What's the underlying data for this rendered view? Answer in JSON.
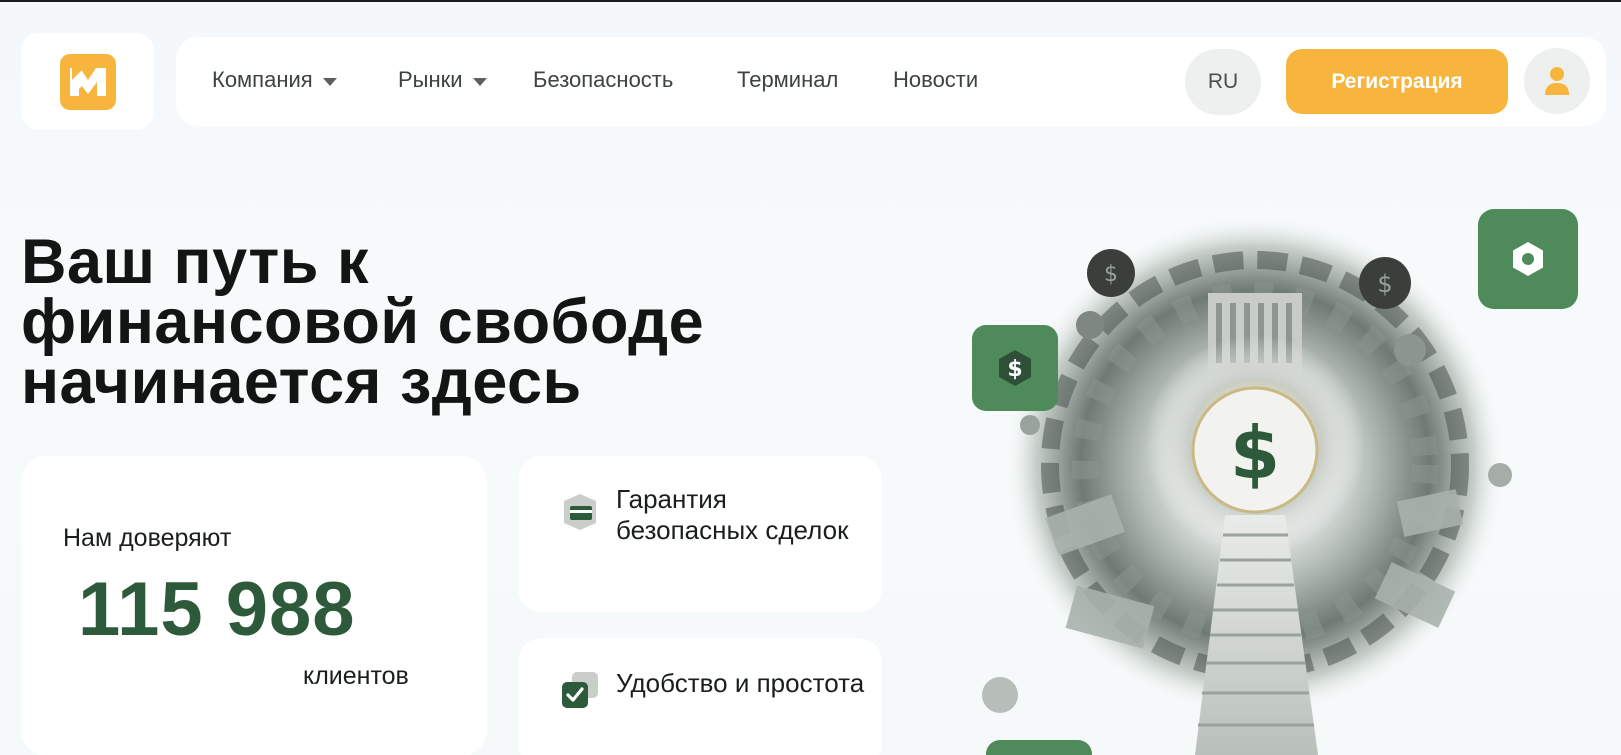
{
  "header": {
    "nav": [
      {
        "label": "Компания",
        "has_dropdown": true
      },
      {
        "label": "Рынки",
        "has_dropdown": true
      },
      {
        "label": "Безопасность",
        "has_dropdown": false
      },
      {
        "label": "Терминал",
        "has_dropdown": false
      },
      {
        "label": "Новости",
        "has_dropdown": false
      }
    ],
    "language": "RU",
    "register_label": "Регистрация",
    "accent_color": "#f7b53d"
  },
  "hero": {
    "title_lines": [
      "Ваш путь к",
      "финансовой свободе",
      "начинается здесь"
    ]
  },
  "trust": {
    "label": "Нам доверяют",
    "count": "115 988",
    "unit": "клиентов",
    "number_color": "#2e5a3c"
  },
  "features": [
    {
      "text": "Гарантия безопасных сделок",
      "icon": "shield-card-icon"
    },
    {
      "text": "Удобство и простота",
      "icon": "check-card-icon"
    }
  ],
  "illustration": {
    "badges": [
      "dollar-icon",
      "hex-nut-icon"
    ],
    "center_symbol": "$",
    "brand_green": "#4f8a5a"
  }
}
